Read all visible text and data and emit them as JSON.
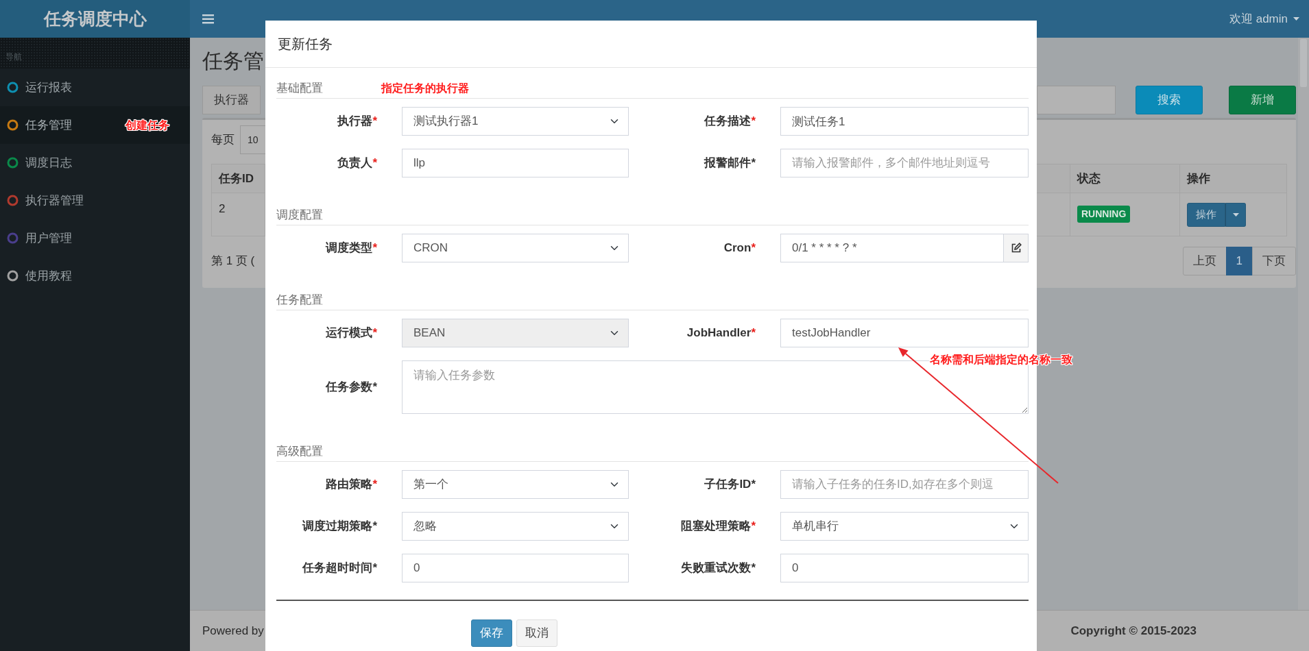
{
  "sidebar": {
    "logo": "任务调度中心",
    "section": "导航",
    "items": [
      {
        "label": "运行报表",
        "color": "#0e8fb0",
        "selected": false
      },
      {
        "label": "任务管理",
        "color": "#c77a12",
        "selected": true,
        "note": "创建任务"
      },
      {
        "label": "调度日志",
        "color": "#0a8a4a",
        "selected": false
      },
      {
        "label": "执行器管理",
        "color": "#b03a2e",
        "selected": false
      },
      {
        "label": "用户管理",
        "color": "#4a3e8c",
        "selected": false
      },
      {
        "label": "使用教程",
        "color": "#a0a0a0",
        "selected": false
      }
    ]
  },
  "topbar": {
    "user": "欢迎 admin"
  },
  "page": {
    "title": "任务管",
    "filter_label": "执行器",
    "search_button": "搜索",
    "add_button": "新增",
    "page_size_label": "每页",
    "page_size": "10",
    "table": {
      "columns": [
        "任务ID",
        "状态",
        "操作"
      ],
      "rows": [
        {
          "id": "2",
          "status": "RUNNING",
          "action": "操作"
        }
      ]
    },
    "page_info": "第 1 页 (",
    "pagination": [
      {
        "label": "上页",
        "selected": false
      },
      {
        "label": "1",
        "selected": true
      },
      {
        "label": "下页",
        "selected": false
      }
    ]
  },
  "footer": {
    "left": "Powered by",
    "right": "Copyright © 2015-2023"
  },
  "modal": {
    "title": "更新任务",
    "sections": [
      {
        "title": "基础配置",
        "note": "指定任务的执行器",
        "fields": [
          {
            "label": "执行器",
            "mark": "*",
            "mark_red": true,
            "kind": "select",
            "value": "测试执行器1",
            "disabled": false
          },
          {
            "label": "任务描述",
            "mark": "*",
            "mark_red": true,
            "kind": "input",
            "value": "测试任务1",
            "disabled": false
          },
          {
            "label": "负责人",
            "mark": "*",
            "mark_red": true,
            "kind": "input",
            "value": "llp",
            "disabled": false
          },
          {
            "label": "报警邮件",
            "mark": "*",
            "mark_red": false,
            "kind": "input",
            "placeholder": "请输入报警邮件，多个邮件地址则逗号",
            "disabled": false
          }
        ]
      },
      {
        "title": "调度配置",
        "fields": [
          {
            "label": "调度类型",
            "mark": "*",
            "mark_red": true,
            "kind": "select",
            "value": "CRON",
            "disabled": false
          },
          {
            "label": "Cron",
            "mark": "*",
            "mark_red": true,
            "kind": "input-addon",
            "value": "0/1 * * * * ? *",
            "disabled": false
          }
        ]
      },
      {
        "title": "任务配置",
        "fields": [
          {
            "label": "运行模式",
            "mark": "*",
            "mark_red": true,
            "kind": "select",
            "value": "BEAN",
            "disabled": true
          },
          {
            "label": "JobHandler",
            "mark": "*",
            "mark_red": true,
            "kind": "input",
            "value": "testJobHandler",
            "disabled": false,
            "note": "名称需和后端指定的名称一致"
          },
          {
            "label": "任务参数",
            "mark": "*",
            "mark_red": false,
            "kind": "textarea",
            "placeholder": "请输入任务参数",
            "disabled": false
          }
        ]
      },
      {
        "title": "高级配置",
        "fields": [
          {
            "label": "路由策略",
            "mark": "*",
            "mark_red": true,
            "kind": "select",
            "value": "第一个",
            "disabled": false
          },
          {
            "label": "子任务ID",
            "mark": "*",
            "mark_red": false,
            "kind": "input",
            "placeholder": "请输入子任务的任务ID,如存在多个则逗",
            "disabled": false
          },
          {
            "label": "调度过期策略",
            "mark": "*",
            "mark_red": false,
            "kind": "select",
            "value": "忽略",
            "disabled": false
          },
          {
            "label": "阻塞处理策略",
            "mark": "*",
            "mark_red": true,
            "kind": "select",
            "value": "单机串行",
            "disabled": false
          },
          {
            "label": "任务超时时间",
            "mark": "*",
            "mark_red": false,
            "kind": "input",
            "value": "0",
            "disabled": false
          },
          {
            "label": "失败重试次数",
            "mark": "*",
            "mark_red": false,
            "kind": "input",
            "value": "0",
            "disabled": false
          }
        ]
      }
    ],
    "buttons": [
      {
        "label": "保存",
        "kind": "primary"
      },
      {
        "label": "取消",
        "kind": "default"
      }
    ]
  }
}
